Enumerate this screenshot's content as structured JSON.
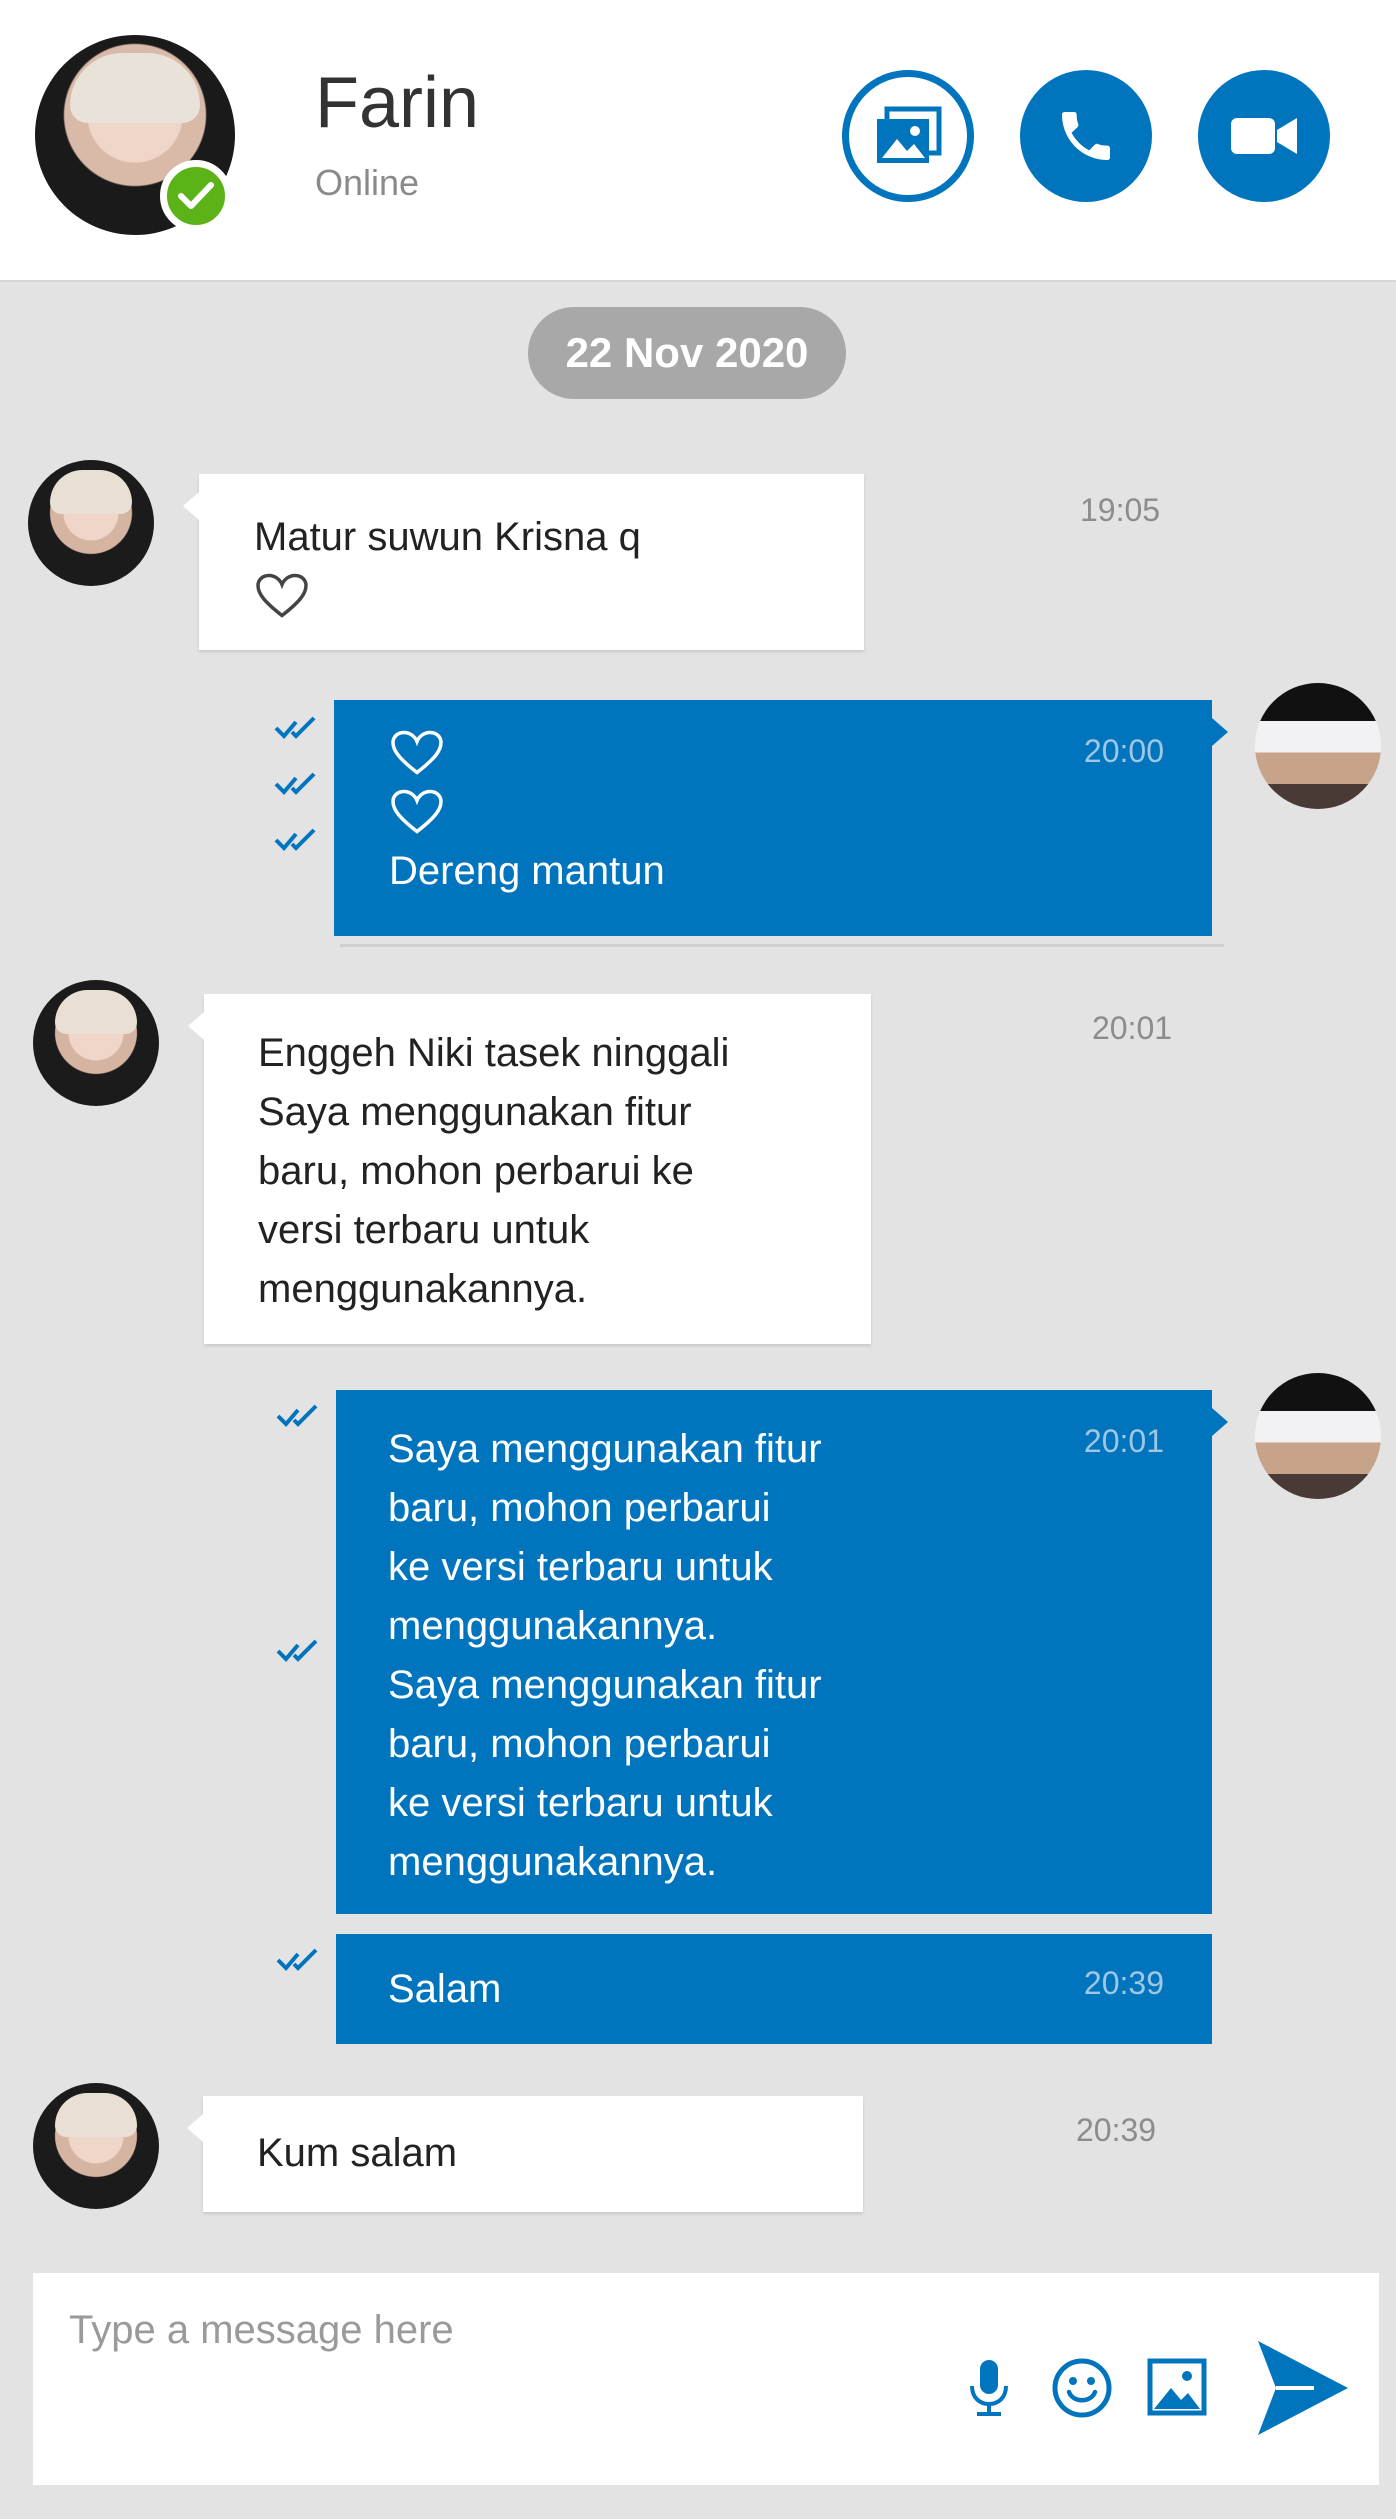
{
  "header": {
    "contact_name": "Farin",
    "status": "Online",
    "accent_color": "#0075be",
    "online_color": "#5bb318",
    "buttons": [
      "gallery-icon",
      "phone-icon",
      "video-camera-icon"
    ]
  },
  "date_divider": "22 Nov 2020",
  "messages": [
    {
      "direction": "in",
      "text": "Matur suwun Krisna q",
      "hearts_after": 1,
      "time": "19:05"
    },
    {
      "direction": "out",
      "hearts_before": 2,
      "text": "Dereng mantun",
      "time": "20:00",
      "status": "read"
    },
    {
      "direction": "in",
      "text": "Enggeh Niki tasek ninggali\nSaya menggunakan fitur\nbaru, mohon perbarui ke\nversi terbaru untuk\nmenggunakannya.",
      "time": "20:01"
    },
    {
      "direction": "out",
      "text": "Saya menggunakan fitur\nbaru, mohon perbarui\nke versi terbaru untuk\nmenggunakannya.\nSaya menggunakan fitur\nbaru, mohon perbarui\nke versi terbaru untuk\nmenggunakannya.",
      "time": "20:01",
      "status": "read"
    },
    {
      "direction": "out",
      "text": "Salam",
      "time": "20:39",
      "status": "read"
    },
    {
      "direction": "in",
      "text": "Kum salam",
      "time": "20:39"
    }
  ],
  "composer": {
    "placeholder": "Type a message here",
    "icons": [
      "microphone-icon",
      "emoji-icon",
      "image-icon",
      "send-icon"
    ]
  }
}
